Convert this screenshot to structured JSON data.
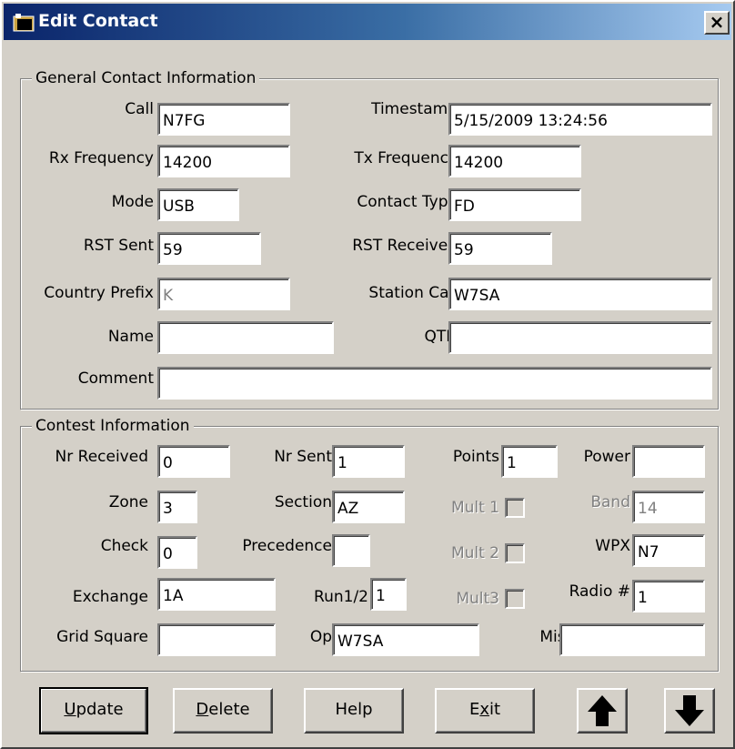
{
  "window": {
    "title": "Edit Contact",
    "close_glyph": "×"
  },
  "general": {
    "legend": "General Contact Information",
    "call": {
      "label": "Call",
      "value": "N7FG"
    },
    "timestamp": {
      "label": "Timestamp",
      "value": "5/15/2009 13:24:56"
    },
    "rx_frequency": {
      "label": "Rx Frequency",
      "value": "14200"
    },
    "tx_frequency": {
      "label": "Tx Frequency",
      "value": "14200"
    },
    "mode": {
      "label": "Mode",
      "value": "USB"
    },
    "contact_type": {
      "label": "Contact Type",
      "value": "FD"
    },
    "rst_sent": {
      "label": "RST Sent",
      "value": "59"
    },
    "rst_received": {
      "label": "RST Received",
      "value": "59"
    },
    "country_prefix": {
      "label": "Country Prefix",
      "value": "K"
    },
    "station_call": {
      "label": "Station Call",
      "value": "W7SA"
    },
    "name": {
      "label": "Name",
      "value": ""
    },
    "qth": {
      "label": "QTH",
      "value": ""
    },
    "comment": {
      "label": "Comment",
      "value": ""
    }
  },
  "contest": {
    "legend": "Contest Information",
    "nr_received": {
      "label": "Nr Received",
      "value": "0"
    },
    "nr_sent": {
      "label": "Nr Sent",
      "value": "1"
    },
    "points": {
      "label": "Points",
      "value": "1"
    },
    "power": {
      "label": "Power",
      "value": ""
    },
    "zone": {
      "label": "Zone",
      "value": "3"
    },
    "section": {
      "label": "Section",
      "value": "AZ"
    },
    "mult1": {
      "label": "Mult 1",
      "checked": false
    },
    "band": {
      "label": "Band",
      "value": "14"
    },
    "check": {
      "label": "Check",
      "value": "0"
    },
    "precedence": {
      "label": "Precedence",
      "value": ""
    },
    "mult2": {
      "label": "Mult 2",
      "checked": false
    },
    "wpx": {
      "label": "WPX",
      "value": "N7"
    },
    "exchange": {
      "label": "Exchange",
      "value": "1A"
    },
    "run12": {
      "label": "Run1/2",
      "value": "1"
    },
    "mult3": {
      "label": "Mult3",
      "checked": false
    },
    "radio": {
      "label": "Radio #",
      "value": "1"
    },
    "grid_square": {
      "label": "Grid Square",
      "value": ""
    },
    "op": {
      "label": "Op",
      "value": "W7SA"
    },
    "misc": {
      "label": "Misc",
      "value": ""
    }
  },
  "buttons": {
    "update": {
      "mnemonic": "U",
      "rest": "pdate"
    },
    "delete": {
      "mnemonic": "D",
      "rest": "elete"
    },
    "help": "Help",
    "exit": {
      "before": "E",
      "mnemonic": "x",
      "after": "it"
    },
    "up_icon": "arrow-up-icon",
    "down_icon": "arrow-down-icon"
  }
}
